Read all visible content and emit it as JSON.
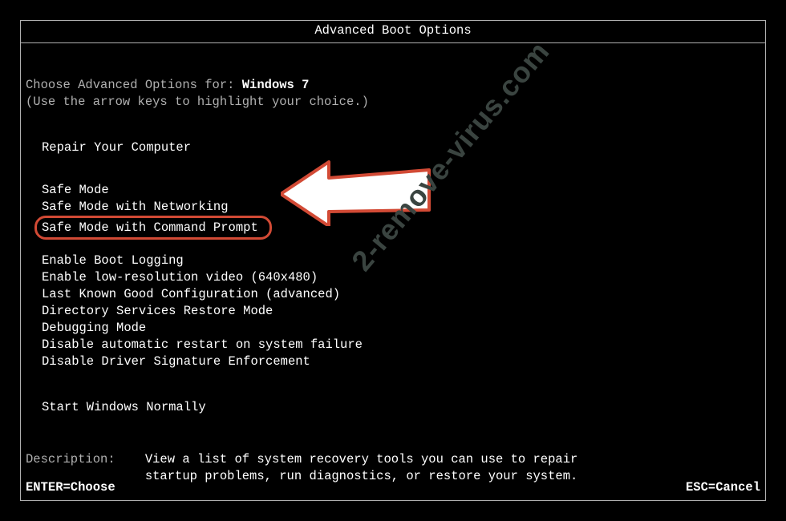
{
  "title": "Advanced Boot Options",
  "intro": {
    "prefix": "Choose Advanced Options for: ",
    "os": "Windows 7",
    "hint": "(Use the arrow keys to highlight your choice.)"
  },
  "groups": {
    "repair": [
      "Repair Your Computer"
    ],
    "safe": [
      "Safe Mode",
      "Safe Mode with Networking",
      "Safe Mode with Command Prompt"
    ],
    "misc": [
      "Enable Boot Logging",
      "Enable low-resolution video (640x480)",
      "Last Known Good Configuration (advanced)",
      "Directory Services Restore Mode",
      "Debugging Mode",
      "Disable automatic restart on system failure",
      "Disable Driver Signature Enforcement"
    ],
    "normal": [
      "Start Windows Normally"
    ]
  },
  "highlighted_option": "Safe Mode with Command Prompt",
  "description": {
    "label": "Description:    ",
    "text": "View a list of system recovery tools you can use to repair startup problems, run diagnostics, or restore your system."
  },
  "footer": {
    "left": "ENTER=Choose",
    "right": "ESC=Cancel"
  },
  "overlay": {
    "watermark": "2-remove-virus.com"
  }
}
